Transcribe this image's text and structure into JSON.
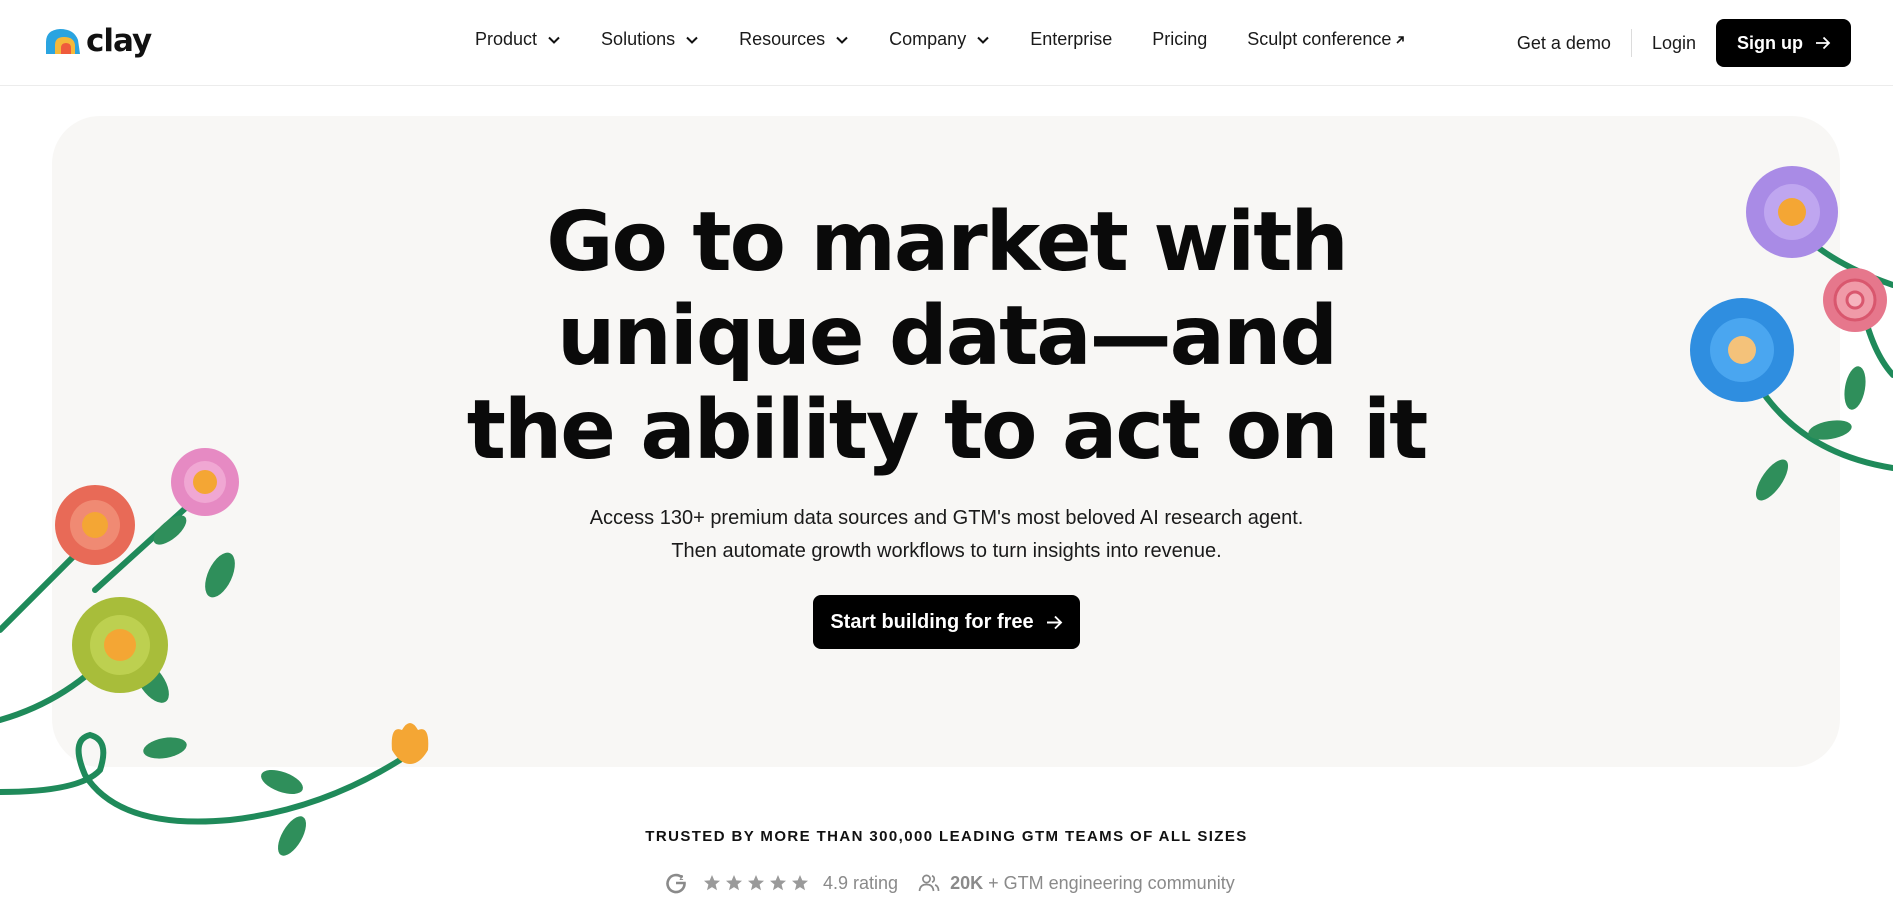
{
  "brand": {
    "name": "clay"
  },
  "nav": {
    "items": [
      {
        "label": "Product",
        "has_dropdown": true
      },
      {
        "label": "Solutions",
        "has_dropdown": true
      },
      {
        "label": "Resources",
        "has_dropdown": true
      },
      {
        "label": "Company",
        "has_dropdown": true
      },
      {
        "label": "Enterprise",
        "has_dropdown": false
      },
      {
        "label": "Pricing",
        "has_dropdown": false
      },
      {
        "label": "Sculpt conference",
        "has_dropdown": false,
        "external": true
      }
    ],
    "get_demo_label": "Get a demo",
    "login_label": "Login",
    "signup_label": "Sign up"
  },
  "hero": {
    "headline_lines": [
      "Go to market with",
      "unique data—and",
      "the ability to act on it"
    ],
    "subtext_lines": [
      "Access 130+ premium data sources and GTM's most beloved AI research agent.",
      "Then automate growth workflows to turn insights into revenue."
    ],
    "cta_label": "Start building for free"
  },
  "trust": {
    "heading": "TRUSTED BY MORE THAN 300,000 LEADING GTM TEAMS OF ALL SIZES",
    "star_count": 5,
    "rating_label": "4.9 rating",
    "community_count": "20K",
    "community_label": " + GTM engineering community"
  },
  "colors": {
    "background": "#ffffff",
    "hero_card": "#f8f7f5",
    "primary_button": "#000000",
    "muted_text": "#8a8a8a"
  }
}
